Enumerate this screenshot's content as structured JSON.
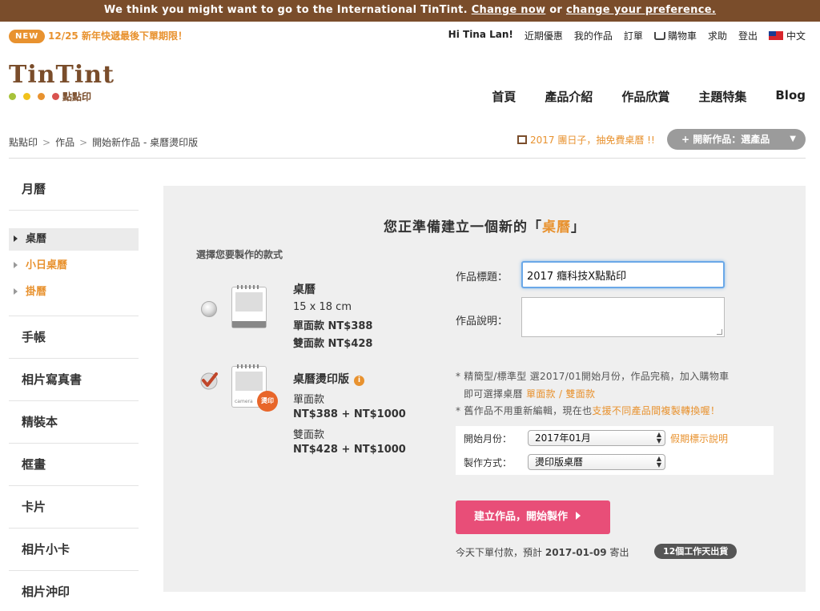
{
  "banner": {
    "text": "We think you might want to go to the International TinTint.",
    "change_now": "Change now",
    "or": "or",
    "change_pref": "change your preference."
  },
  "topbar": {
    "badge": "NEW",
    "promo": "12/25 新年快遞最後下單期限！",
    "user_greeting": "Hi Tina Lan!",
    "links": [
      "近期優惠",
      "我的作品",
      "訂單"
    ],
    "cart": "購物車",
    "help": "求助",
    "logout": "登出",
    "language": "中文"
  },
  "logo": {
    "text": "TinTint",
    "sub": "點點印",
    "dot_colors": [
      "#a7c23a",
      "#f1c21b",
      "#e8922f",
      "#d9534f"
    ]
  },
  "mainnav": [
    "首頁",
    "產品介紹",
    "作品欣賞",
    "主題特集",
    "Blog"
  ],
  "breadcrumb": {
    "items": [
      "點點印",
      "作品",
      "開始新作品 - 桌曆燙印版"
    ],
    "sep": ">"
  },
  "notice": "2017 團日子，抽免費桌曆 !!",
  "new_work_button": "+ 開新作品：選產品",
  "sidebar": {
    "top": "月曆",
    "subs": [
      "桌曆",
      "小日桌曆",
      "掛曆"
    ],
    "cats": [
      "手帳",
      "相片寫真書",
      "精裝本",
      "框畫",
      "卡片",
      "相片小卡",
      "相片沖印"
    ]
  },
  "panel": {
    "title_prefix": "您正準備建立一個新的「",
    "title_highlight": "桌曆",
    "title_suffix": "」",
    "choose_label": "選擇您要製作的款式",
    "product1": {
      "name": "桌曆",
      "size": "15 x 18 cm",
      "single": "單面款 NT$388",
      "double": "雙面款 NT$428"
    },
    "product2": {
      "name": "桌曆燙印版",
      "info": "i",
      "stamp": "燙印",
      "cam": "camera",
      "single_label": "單面款",
      "single_price": "NT$388 + NT$1000",
      "double_label": "雙面款",
      "double_price": "NT$428 + NT$1000"
    },
    "form": {
      "title_label": "作品標題：",
      "title_value": "2017 癮科技X點點印",
      "desc_label": "作品說明："
    },
    "notes": {
      "n1": "* 精簡型/標準型 選2017/01開始月份，作品完稿，加入購物車",
      "n2_prefix": "即可選擇桌曆",
      "n2_link": "單面款 / 雙面款",
      "n3_prefix": "* 舊作品不用重新編輯，現在也",
      "n3_link": "支援不同產品間複製轉換喔！"
    },
    "options": {
      "start_label": "開始月份：",
      "start_value": "2017年01月",
      "holiday_link": "假期標示說明",
      "method_label": "製作方式：",
      "method_value": "燙印版桌曆"
    },
    "create_button": "建立作品，開始製作",
    "ship_prefix": "今天下單付款，預計",
    "ship_date": "2017-01-09",
    "ship_suffix": "寄出",
    "ship_badge": "12個工作天出貨"
  }
}
